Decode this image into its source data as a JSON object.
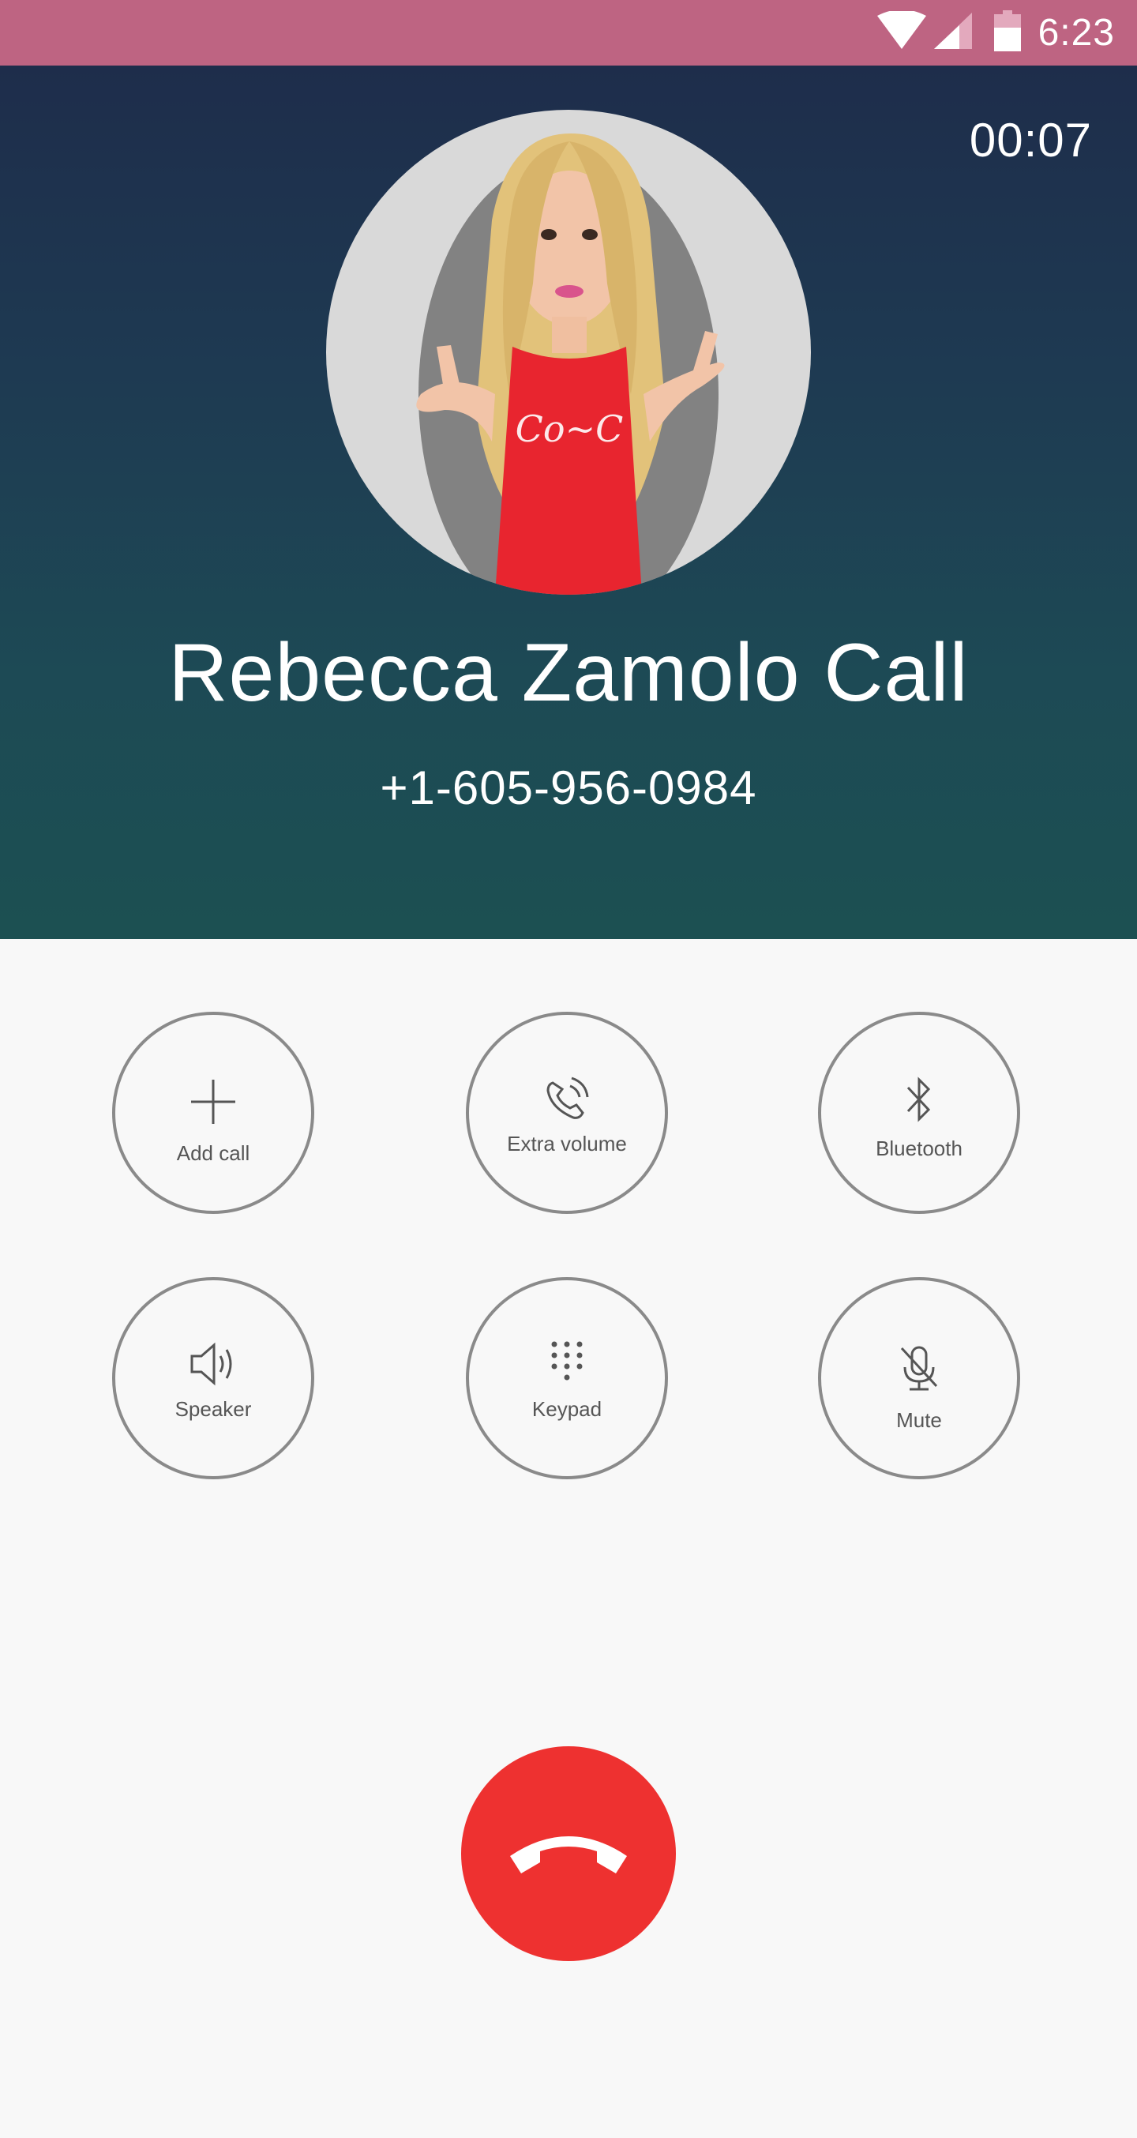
{
  "status_bar": {
    "time": "6:23",
    "icons": [
      "wifi-icon",
      "signal-icon",
      "battery-icon"
    ],
    "background": "#be6482"
  },
  "call": {
    "timer": "00:07",
    "caller_name": "Rebecca Zamolo Call",
    "caller_number": "+1-605-956-0984"
  },
  "actions": [
    {
      "label": "Add call",
      "icon": "plus-icon"
    },
    {
      "label": "Extra volume",
      "icon": "phone-volume-icon"
    },
    {
      "label": "Bluetooth",
      "icon": "bluetooth-icon"
    },
    {
      "label": "Speaker",
      "icon": "speaker-icon"
    },
    {
      "label": "Keypad",
      "icon": "keypad-icon"
    },
    {
      "label": "Mute",
      "icon": "mic-off-icon"
    }
  ],
  "end_call": {
    "icon": "end-call-icon",
    "color": "#ee3130"
  },
  "colors": {
    "header_top": "#1e2d4b",
    "header_bottom": "#1c5052",
    "button_border": "#8a8a8a",
    "page_background": "#f8f8f8"
  }
}
